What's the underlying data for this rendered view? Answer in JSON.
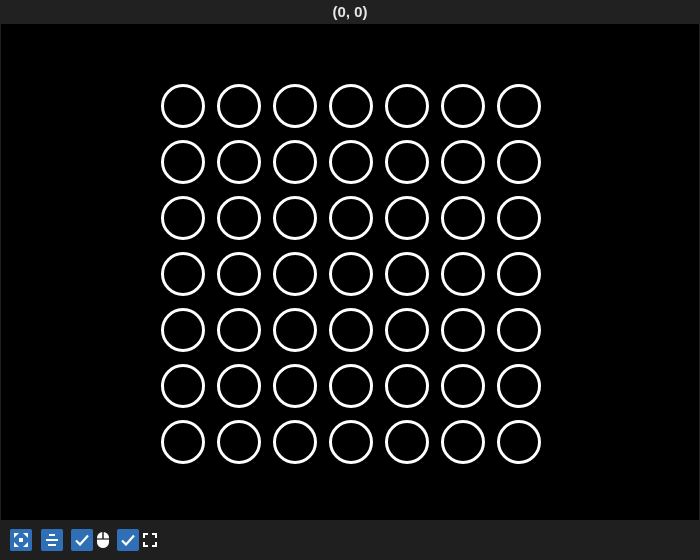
{
  "window": {
    "title": "(0, 0)"
  },
  "canvas": {
    "background": "#000000",
    "grid": {
      "rows": 7,
      "cols": 7,
      "ring_color": "#ffffff"
    }
  },
  "toolbar": {
    "accent": "#2f6fb6",
    "items": [
      {
        "icon": "fit-view-icon",
        "kind": "button"
      },
      {
        "icon": "align-center-icon",
        "kind": "button"
      },
      {
        "icon": "checkbox-checked-icon",
        "kind": "checkbox",
        "checked": true
      },
      {
        "icon": "mouse-icon",
        "kind": "icon"
      },
      {
        "icon": "checkbox-checked-icon",
        "kind": "checkbox",
        "checked": true
      },
      {
        "icon": "fullscreen-icon",
        "kind": "icon"
      }
    ]
  }
}
